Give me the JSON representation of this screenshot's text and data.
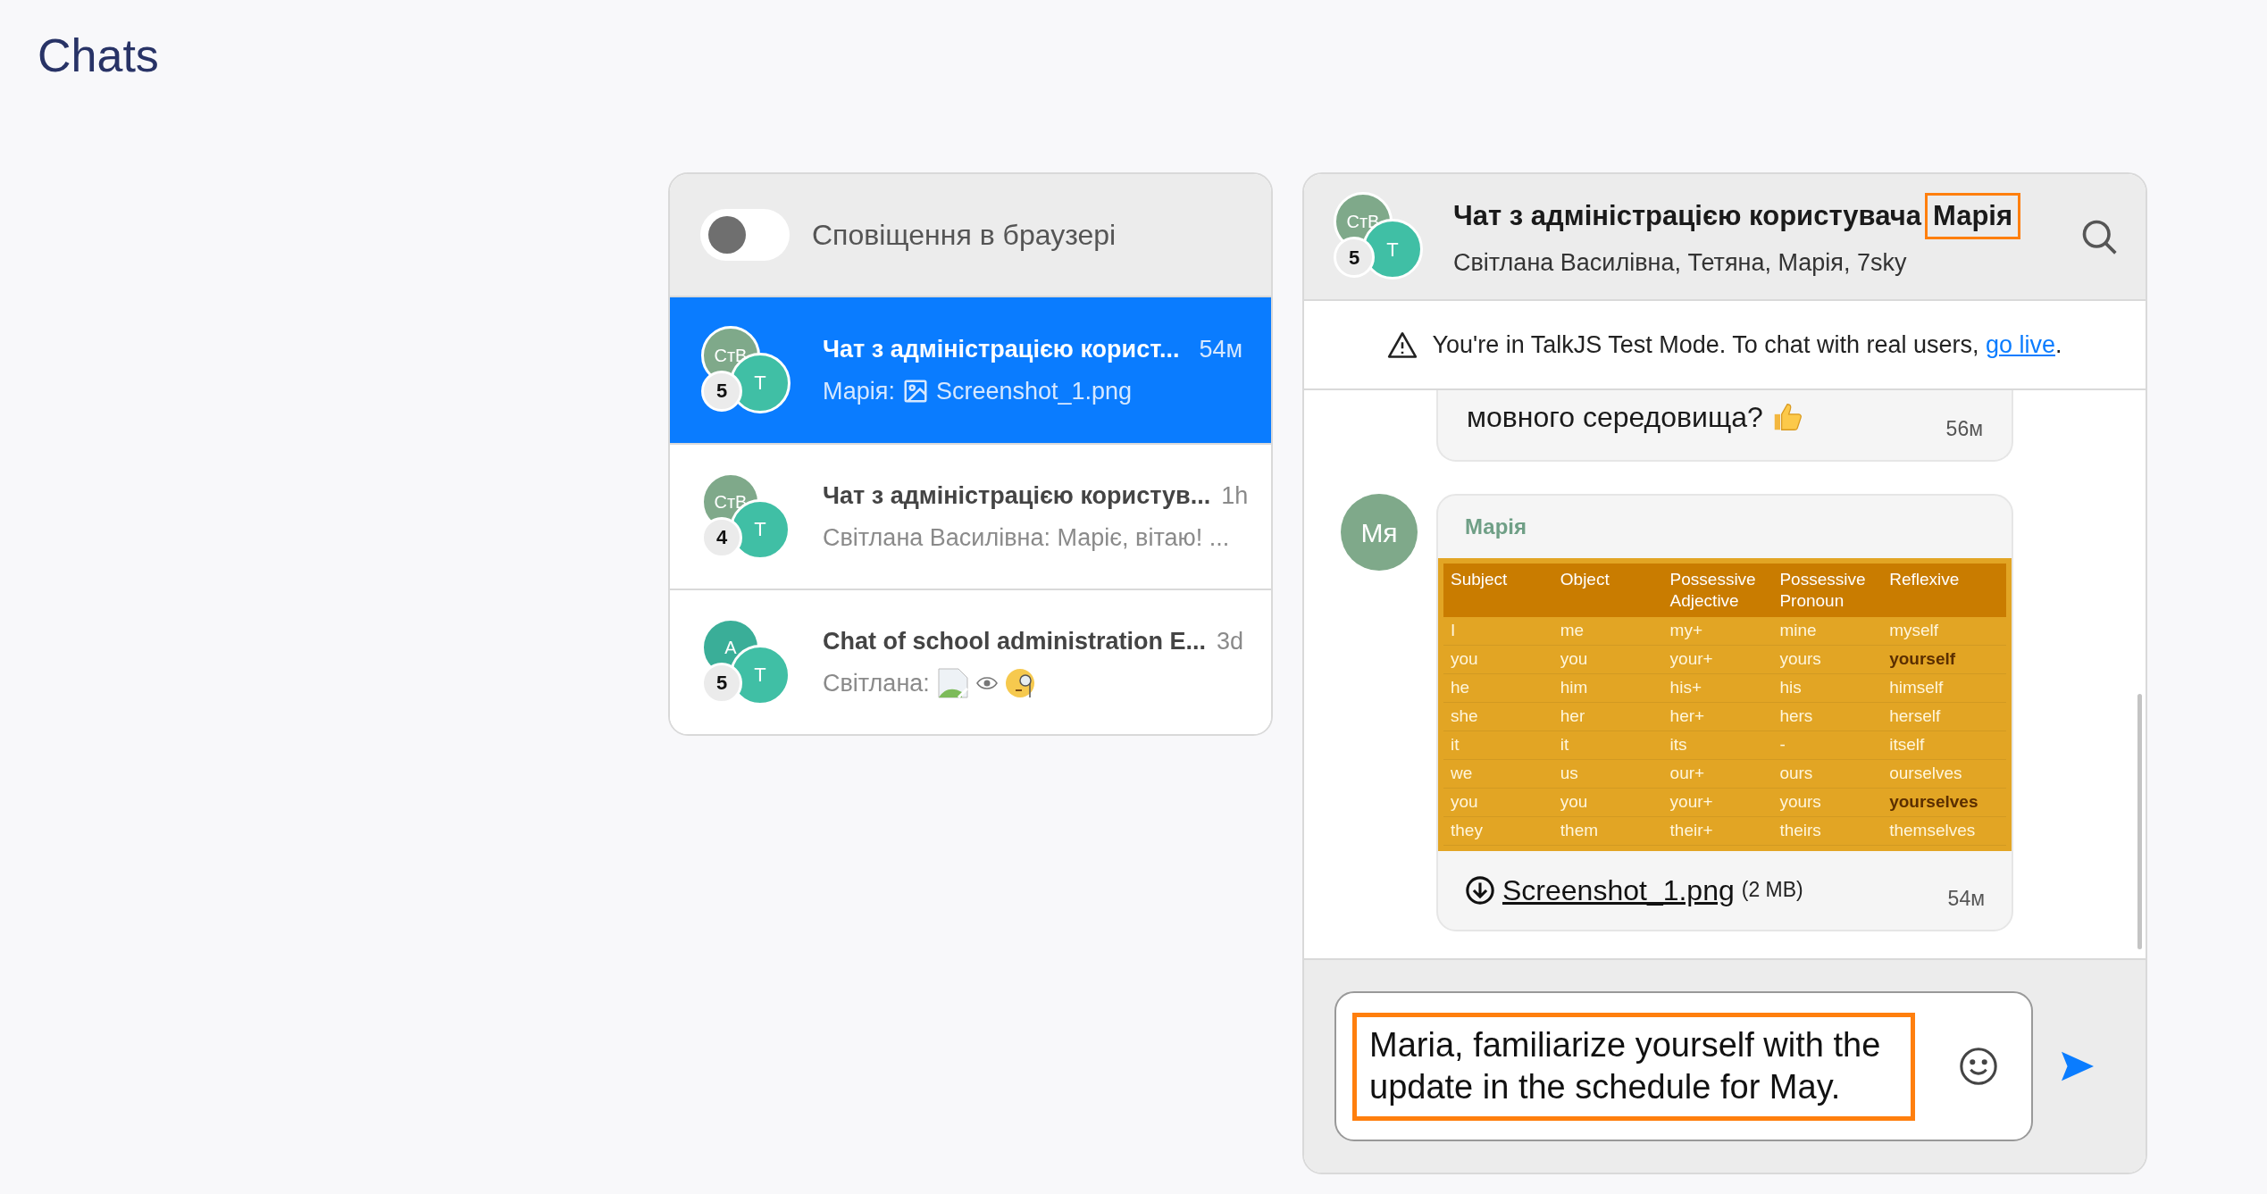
{
  "page_title": "Chats",
  "notifications": {
    "label": "Сповіщення в браузері",
    "on": false
  },
  "conversations": [
    {
      "title": "Чат з адміністрацією корист...",
      "time": "54м",
      "sender": "Марія:",
      "preview": "Screenshot_1.png",
      "kind": "file",
      "selected": true,
      "avatars": [
        {
          "initials": "СтВ",
          "color": "#7fa98a"
        },
        {
          "initials": "Т",
          "color": "#40bfa5"
        }
      ],
      "count": "5"
    },
    {
      "title": "Чат з адміністрацією користув...",
      "time": "1h",
      "sender": "Світлана Василівна:",
      "preview": "Маріє, вітаю! ...",
      "kind": "text",
      "selected": false,
      "avatars": [
        {
          "initials": "СтВ",
          "color": "#7fa98a"
        },
        {
          "initials": "Т",
          "color": "#40bfa5"
        }
      ],
      "count": "4"
    },
    {
      "title": "Chat of school administration E...",
      "time": "3d",
      "sender": "Світлана:",
      "kind": "images",
      "selected": false,
      "avatars": [
        {
          "initials": "А",
          "color": "#3aae98"
        },
        {
          "initials": "Т",
          "color": "#40bfa5"
        }
      ],
      "count": "5"
    }
  ],
  "chat": {
    "title": "Чат з адміністрацією користувача",
    "title_highlight": "Марія",
    "members": "Світлана Василівна, Тетяна, Марія, 7sky",
    "avatars": [
      {
        "initials": "СтВ",
        "color": "#7fa98a"
      },
      {
        "initials": "Т",
        "color": "#40bfa5"
      }
    ],
    "count": "5",
    "banner": {
      "text": "You're in TalkJS Test Mode. To chat with real users,",
      "link": "go live",
      "end": "."
    },
    "messages": [
      {
        "kind": "text",
        "text": "мовного середовища?",
        "time": "56м"
      },
      {
        "kind": "file",
        "author": {
          "initials": "Мя",
          "color": "#7fa98a"
        },
        "sender": "Марія",
        "table": {
          "columns": [
            "Subject",
            "Object",
            "Possessive Adjective",
            "Possessive Pronoun",
            "Reflexive"
          ],
          "rows": [
            {
              "cells": [
                "I",
                "me",
                "my+",
                "mine",
                "myself"
              ],
              "emphasized": false
            },
            {
              "cells": [
                "you",
                "you",
                "your+",
                "yours",
                "yourself"
              ],
              "emphasized": true
            },
            {
              "cells": [
                "he",
                "him",
                "his+",
                "his",
                "himself"
              ],
              "emphasized": false
            },
            {
              "cells": [
                "she",
                "her",
                "her+",
                "hers",
                "herself"
              ],
              "emphasized": false
            },
            {
              "cells": [
                "it",
                "it",
                "its",
                "-",
                "itself"
              ],
              "emphasized": false
            },
            {
              "cells": [
                "we",
                "us",
                "our+",
                "ours",
                "ourselves"
              ],
              "emphasized": false
            },
            {
              "cells": [
                "you",
                "you",
                "your+",
                "yours",
                "yourselves"
              ],
              "emphasized": true
            },
            {
              "cells": [
                "they",
                "them",
                "their+",
                "theirs",
                "themselves"
              ],
              "emphasized": false
            }
          ]
        },
        "file": "Screenshot_1.png",
        "size": "(2 MB)",
        "time": "54м"
      }
    ],
    "composer": {
      "value": "Maria, familiarize yourself with the update in the schedule for May.",
      "highlighted": true
    }
  }
}
